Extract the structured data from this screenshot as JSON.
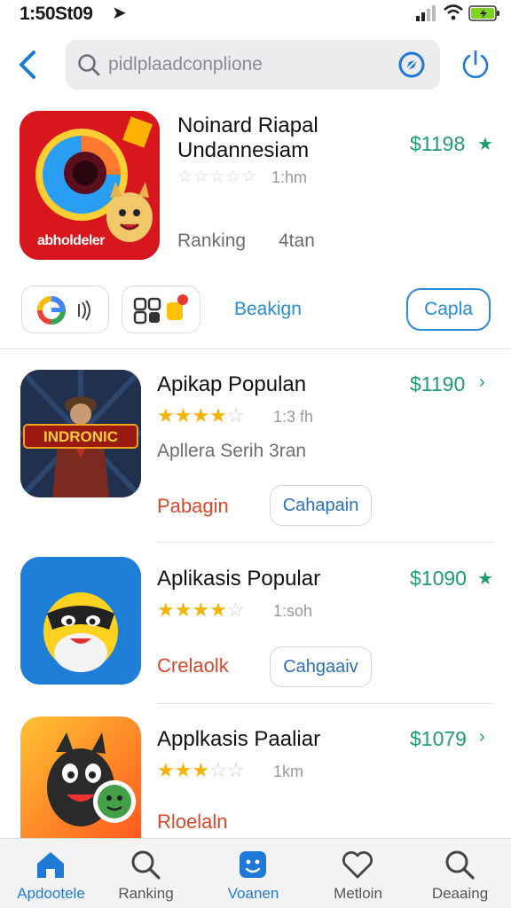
{
  "status": {
    "time": "1:50St09",
    "location_icon": "location-arrow-icon"
  },
  "search": {
    "placeholder": "pidlplaadconplione"
  },
  "featured": {
    "icon_label": "abholdeler",
    "title_line1": "Noinard Riapal",
    "title_line2": "Undannesiam",
    "review_count": "1:hm",
    "ranking_label": "Ranking",
    "ranking_value": "4tan",
    "price": "$1198",
    "stars": 0
  },
  "chips": {
    "text": "Beakign",
    "button": "Capla"
  },
  "items": [
    {
      "title": "Apikap Populan",
      "stars": 4,
      "review_count": "1:3 fh",
      "subtitle": "Apllera Serih 3ran",
      "action": "Pabagin",
      "button": "Cahapain",
      "price": "$1190",
      "mark": "arrow",
      "icon_text": "INDRONIC"
    },
    {
      "title": "Aplikasis Popular",
      "stars": 4,
      "review_count": "1:soh",
      "subtitle": "",
      "action": "Crelaolk",
      "button": "Cahgaaiv",
      "price": "$1090",
      "mark": "star"
    },
    {
      "title": "Applkasis Paaliar",
      "stars": 3,
      "review_count": "1km",
      "subtitle": "",
      "action": "Rloelaln",
      "button": "",
      "price": "$1079",
      "mark": "arrow"
    }
  ],
  "tabs": [
    {
      "label": "Apdootele",
      "icon": "home-icon",
      "active": true
    },
    {
      "label": "Ranking",
      "icon": "search-icon",
      "active": false
    },
    {
      "label": "Voanen",
      "icon": "face-icon",
      "active": true
    },
    {
      "label": "Metloin",
      "icon": "heart-icon",
      "active": false
    },
    {
      "label": "Deaaing",
      "icon": "search-icon",
      "active": false
    }
  ],
  "colors": {
    "accent": "#2b8bd6",
    "price": "#1f9d6a",
    "star": "#f2b400",
    "action_red": "#d9472a"
  }
}
